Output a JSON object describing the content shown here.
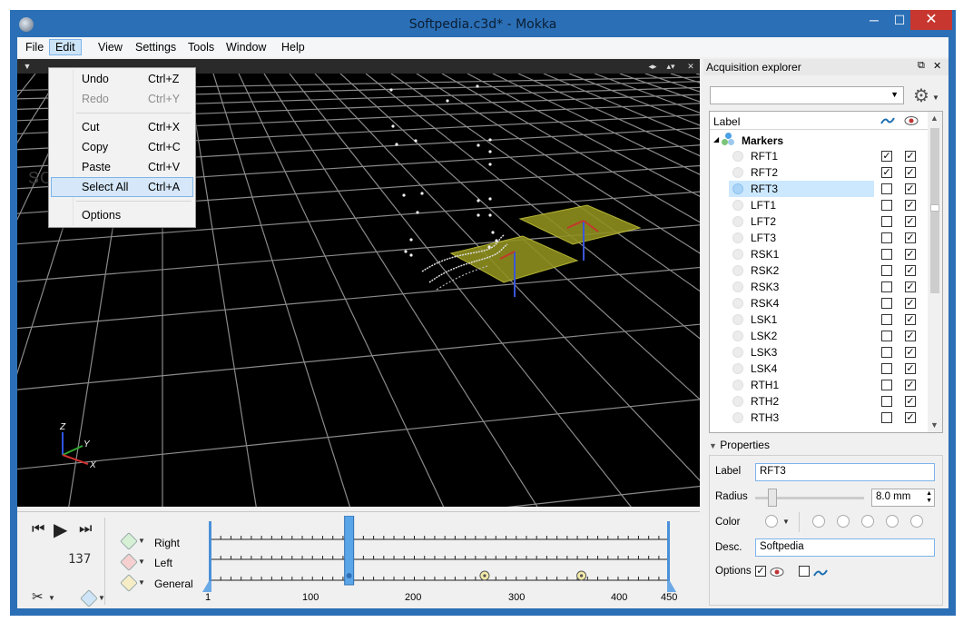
{
  "window": {
    "title": "Softpedia.c3d* - Mokka",
    "minimize_glyph": "─",
    "maximize_glyph": "☐",
    "close_glyph": "✕"
  },
  "menubar": [
    "File",
    "Edit",
    "View",
    "Settings",
    "Tools",
    "Window",
    "Help"
  ],
  "edit_menu": {
    "items": [
      {
        "label": "Undo",
        "shortcut": "Ctrl+Z",
        "enabled": true
      },
      {
        "label": "Redo",
        "shortcut": "Ctrl+Y",
        "enabled": false
      },
      {
        "label": "Cut",
        "shortcut": "Ctrl+X",
        "enabled": true
      },
      {
        "label": "Copy",
        "shortcut": "Ctrl+C",
        "enabled": true
      },
      {
        "label": "Paste",
        "shortcut": "Ctrl+V",
        "enabled": true
      },
      {
        "label": "Select All",
        "shortcut": "Ctrl+A",
        "enabled": true,
        "highlighted": true
      },
      {
        "label": "Options",
        "shortcut": "",
        "enabled": true
      }
    ]
  },
  "view3d": {
    "watermark": "SOFTPEDIA",
    "axis_labels": {
      "z": "Z",
      "y": "Y",
      "x": "X"
    },
    "background": "#000000",
    "grid_color": "#8a8a8a",
    "forceplate_color": "#8f8f20"
  },
  "timeline": {
    "frame_counter": "137",
    "tracks": [
      "Right",
      "Left",
      "General"
    ],
    "axis_ticks": [
      "1",
      "100",
      "200",
      "300",
      "400",
      "450"
    ],
    "current_frame": 137,
    "first_frame": 1,
    "last_frame": 450,
    "general_events": [
      137,
      270,
      365
    ]
  },
  "explorer": {
    "title": "Acquisition explorer",
    "combo_value": "",
    "column_label": "Label",
    "group_name": "Markers",
    "markers": [
      {
        "name": "RFT1",
        "traj": true,
        "visible": true,
        "selected": false
      },
      {
        "name": "RFT2",
        "traj": true,
        "visible": true,
        "selected": false
      },
      {
        "name": "RFT3",
        "traj": false,
        "visible": true,
        "selected": true
      },
      {
        "name": "LFT1",
        "traj": false,
        "visible": true,
        "selected": false
      },
      {
        "name": "LFT2",
        "traj": false,
        "visible": true,
        "selected": false
      },
      {
        "name": "LFT3",
        "traj": false,
        "visible": true,
        "selected": false
      },
      {
        "name": "RSK1",
        "traj": false,
        "visible": true,
        "selected": false
      },
      {
        "name": "RSK2",
        "traj": false,
        "visible": true,
        "selected": false
      },
      {
        "name": "RSK3",
        "traj": false,
        "visible": true,
        "selected": false
      },
      {
        "name": "RSK4",
        "traj": false,
        "visible": true,
        "selected": false
      },
      {
        "name": "LSK1",
        "traj": false,
        "visible": true,
        "selected": false
      },
      {
        "name": "LSK2",
        "traj": false,
        "visible": true,
        "selected": false
      },
      {
        "name": "LSK3",
        "traj": false,
        "visible": true,
        "selected": false
      },
      {
        "name": "LSK4",
        "traj": false,
        "visible": true,
        "selected": false
      },
      {
        "name": "RTH1",
        "traj": false,
        "visible": true,
        "selected": false
      },
      {
        "name": "RTH2",
        "traj": false,
        "visible": true,
        "selected": false
      },
      {
        "name": "RTH3",
        "traj": false,
        "visible": true,
        "selected": false
      }
    ]
  },
  "properties": {
    "title": "Properties",
    "label_caption": "Label",
    "label_value": "RFT3",
    "radius_caption": "Radius",
    "radius_value": "8.0 mm",
    "color_caption": "Color",
    "desc_caption": "Desc.",
    "desc_value": "Softpedia",
    "options_caption": "Options"
  },
  "colors": {
    "title_bar": "#2b6fb6",
    "close_button": "#c7372f",
    "selection": "#cce8ff",
    "accent": "#7eb4ea"
  }
}
